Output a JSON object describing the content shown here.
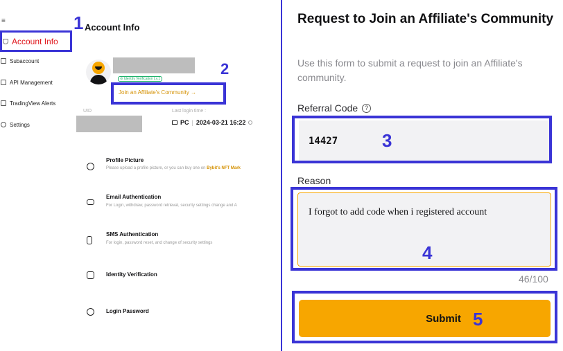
{
  "sidebar": {
    "menu_glyph": "≡",
    "items": [
      {
        "label": "Account Info",
        "icon": "shield-icon",
        "active": true
      },
      {
        "label": "Subaccount",
        "icon": "subaccount-icon"
      },
      {
        "label": "API Management",
        "icon": "api-icon"
      },
      {
        "label": "TradingView Alerts",
        "icon": "alert-icon"
      },
      {
        "label": "Settings",
        "icon": "settings-icon"
      }
    ]
  },
  "account": {
    "title": "Account Info",
    "verification_badge": "⊘ Identity Verification Lv.1",
    "join_link": "Join an Affiliate's Community →",
    "uid_label": "UID",
    "last_login_label": "Last login time :",
    "last_login_device": "PC",
    "last_login_time": "2024-03-21 16:22",
    "security_items": [
      {
        "title": "Profile Picture",
        "desc": "Please upload a profile picture, or you can buy one on ",
        "desc_link": "Bybit's NFT Mark",
        "icon": "profile-picture-icon"
      },
      {
        "title": "Email Authentication",
        "desc": "For Login, withdraw, password retrieval, security settings change and A",
        "icon": "email-icon"
      },
      {
        "title": "SMS Authentication",
        "desc": "For login, password reset, and change of security settings",
        "icon": "phone-icon"
      },
      {
        "title": "Identity Verification",
        "desc": "",
        "icon": "id-card-icon"
      },
      {
        "title": "Login Password",
        "desc": "",
        "icon": "lock-icon"
      }
    ]
  },
  "form": {
    "title": "Request to Join an Affiliate's Community",
    "description": "Use this form to submit a request to join an Affiliate's community.",
    "referral_label": "Referral Code",
    "referral_help_glyph": "?",
    "referral_value": "14427",
    "reason_label": "Reason",
    "reason_value": "I forgot to add code when i registered account",
    "counter": "46/100",
    "submit_label": "Submit"
  },
  "annotations": [
    "1",
    "2",
    "3",
    "4",
    "5"
  ],
  "colors": {
    "annotation": "#3a34d6",
    "accent": "#f7a600",
    "active_nav_text": "#e0171c",
    "verify_green": "#20b26c"
  }
}
